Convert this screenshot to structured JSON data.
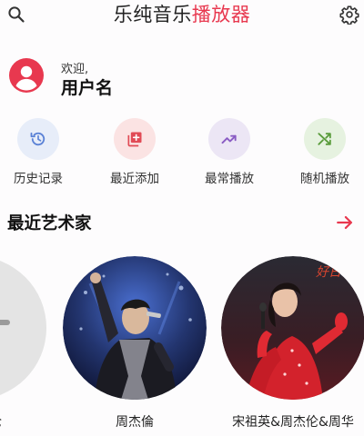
{
  "header": {
    "title_main": "乐纯音乐",
    "title_accent": "播放器",
    "search_icon": "search-icon",
    "settings_icon": "gear-icon",
    "accent_color": "#e8384f"
  },
  "user": {
    "welcome": "欢迎,",
    "name": "用户名",
    "avatar_icon": "user-avatar-icon"
  },
  "quick_actions": [
    {
      "label": "历史记录",
      "icon": "history-icon",
      "bg": "#e7edf9",
      "color": "#5b82d6"
    },
    {
      "label": "最近添加",
      "icon": "add-playlist-icon",
      "bg": "#fbe3e3",
      "color": "#e14b56"
    },
    {
      "label": "最常播放",
      "icon": "trending-up-icon",
      "bg": "#ece6f5",
      "color": "#8a5cc4"
    },
    {
      "label": "随机播放",
      "icon": "shuffle-icon",
      "bg": "#e6f2e0",
      "color": "#5a9c3c"
    }
  ],
  "recent_artists": {
    "title": "最近艺术家",
    "more_icon": "arrow-right-icon",
    "items": [
      {
        "name": "伦"
      },
      {
        "name": "周杰倫"
      },
      {
        "name": "宋祖英&周杰伦&周华"
      }
    ]
  }
}
